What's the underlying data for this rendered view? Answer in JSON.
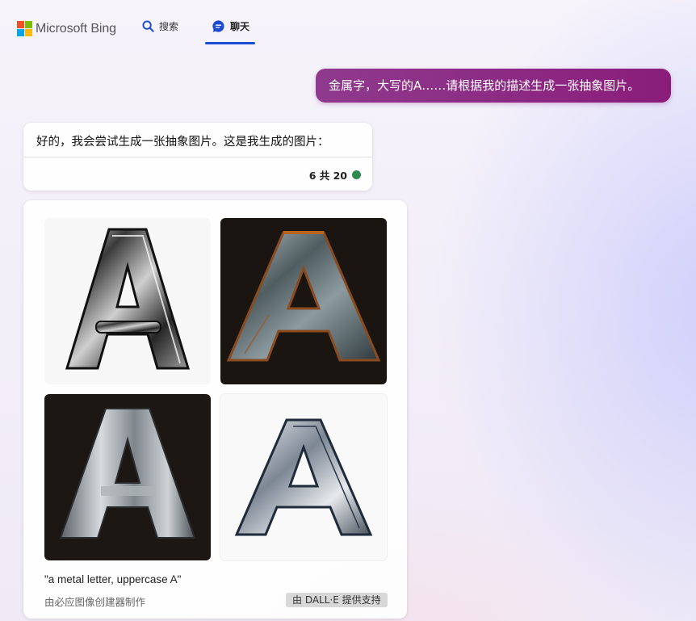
{
  "header": {
    "brand": "Microsoft Bing",
    "tabs": [
      {
        "label": "搜索",
        "icon": "search-icon",
        "active": false
      },
      {
        "label": "聊天",
        "icon": "chat-icon",
        "active": true
      }
    ],
    "accent_color": "#1a4bd0"
  },
  "conversation": {
    "user_message": "金属字，大写的A……请根据我的描述生成一张抽象图片。",
    "bot_message": "好的，我会尝试生成一张抽象图片。这是我生成的图片：",
    "turn_counter": "6 共 20",
    "counter_status_color": "#2e8b4f"
  },
  "image_result": {
    "images": [
      {
        "alt": "metal letter A on white background"
      },
      {
        "alt": "rusty metal letter A on dark background"
      },
      {
        "alt": "brushed steel letter A on dark background"
      },
      {
        "alt": "chrome outline letter A on white background"
      }
    ],
    "prompt": "\"a metal letter, uppercase A\"",
    "maker_note": "由必应图像创建器制作",
    "powered_by": "由 DALL·E 提供支持"
  }
}
